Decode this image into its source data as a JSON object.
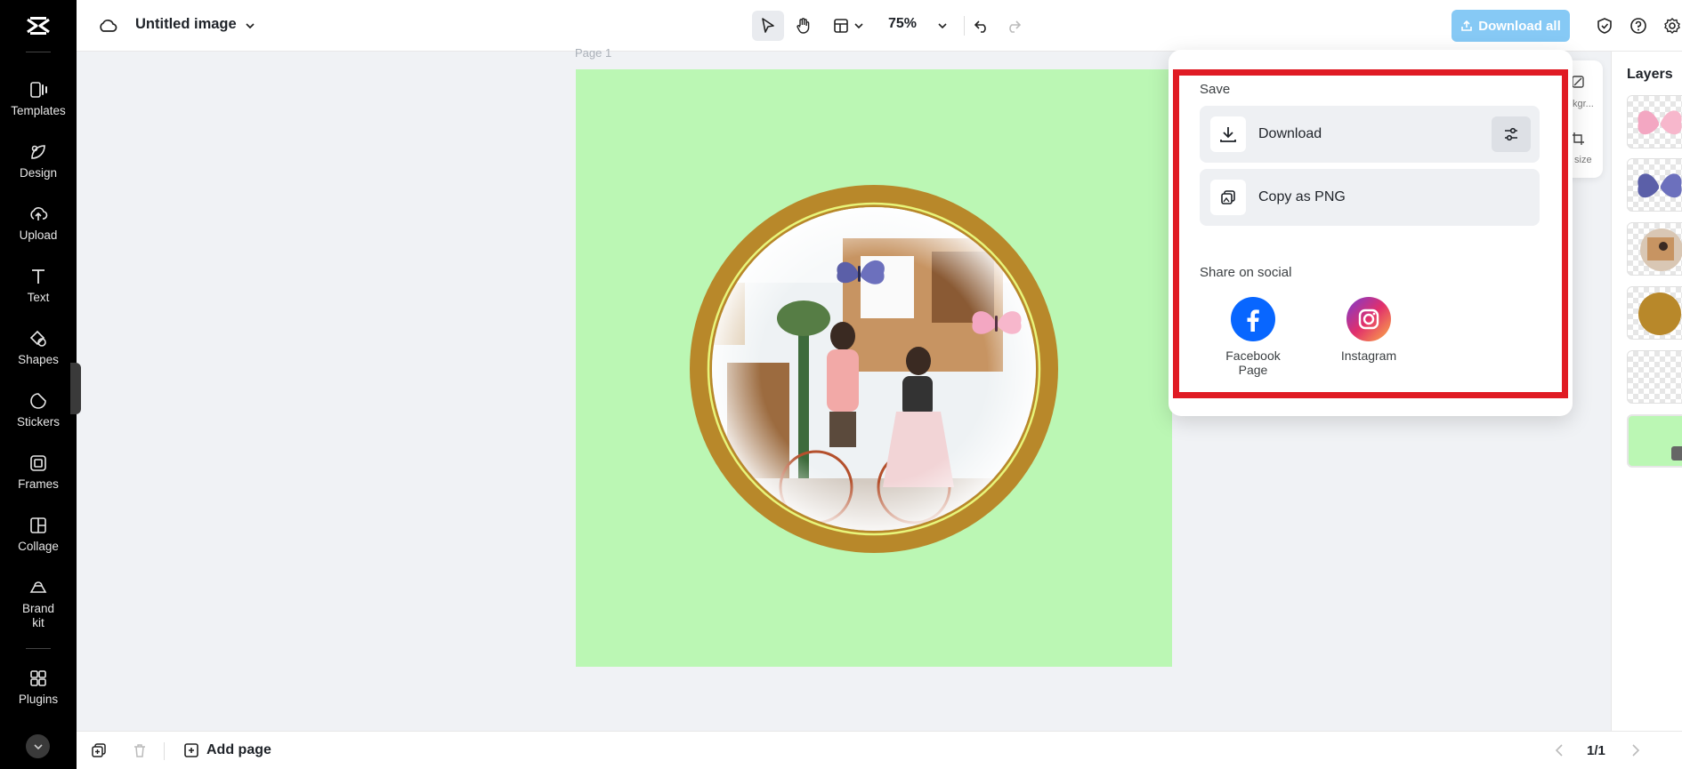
{
  "app": {
    "document_title": "Untitled image",
    "zoom": "75%",
    "download_all_label": "Download all",
    "page_label": "Page 1"
  },
  "rail": {
    "items": [
      {
        "label": "Templates",
        "icon": "templates-icon"
      },
      {
        "label": "Design",
        "icon": "design-icon"
      },
      {
        "label": "Upload",
        "icon": "upload-icon"
      },
      {
        "label": "Text",
        "icon": "text-icon"
      },
      {
        "label": "Shapes",
        "icon": "shapes-icon"
      },
      {
        "label": "Stickers",
        "icon": "stickers-icon"
      },
      {
        "label": "Frames",
        "icon": "frames-icon"
      },
      {
        "label": "Collage",
        "icon": "collage-icon"
      },
      {
        "label": "Brand kit",
        "icon": "brand-kit-icon"
      },
      {
        "label": "Plugins",
        "icon": "plugins-icon"
      }
    ]
  },
  "right_panel": {
    "layers_title": "Layers",
    "mini_labels": [
      "kgr...",
      "size"
    ]
  },
  "popover": {
    "save_heading": "Save",
    "download_label": "Download",
    "copy_label": "Copy as PNG",
    "share_heading": "Share on social",
    "social": [
      {
        "label": "Facebook Page",
        "icon": "facebook-icon",
        "color": "#0866ff"
      },
      {
        "label": "Instagram",
        "icon": "instagram-icon",
        "color": "#e1306c"
      }
    ]
  },
  "bottom": {
    "add_page_label": "Add page",
    "pager": "1/1"
  },
  "colors": {
    "canvas_bg": "#bbf7b4",
    "ring": "#b8882a",
    "highlight": "#e01b24",
    "accent": "#86c9f5"
  }
}
